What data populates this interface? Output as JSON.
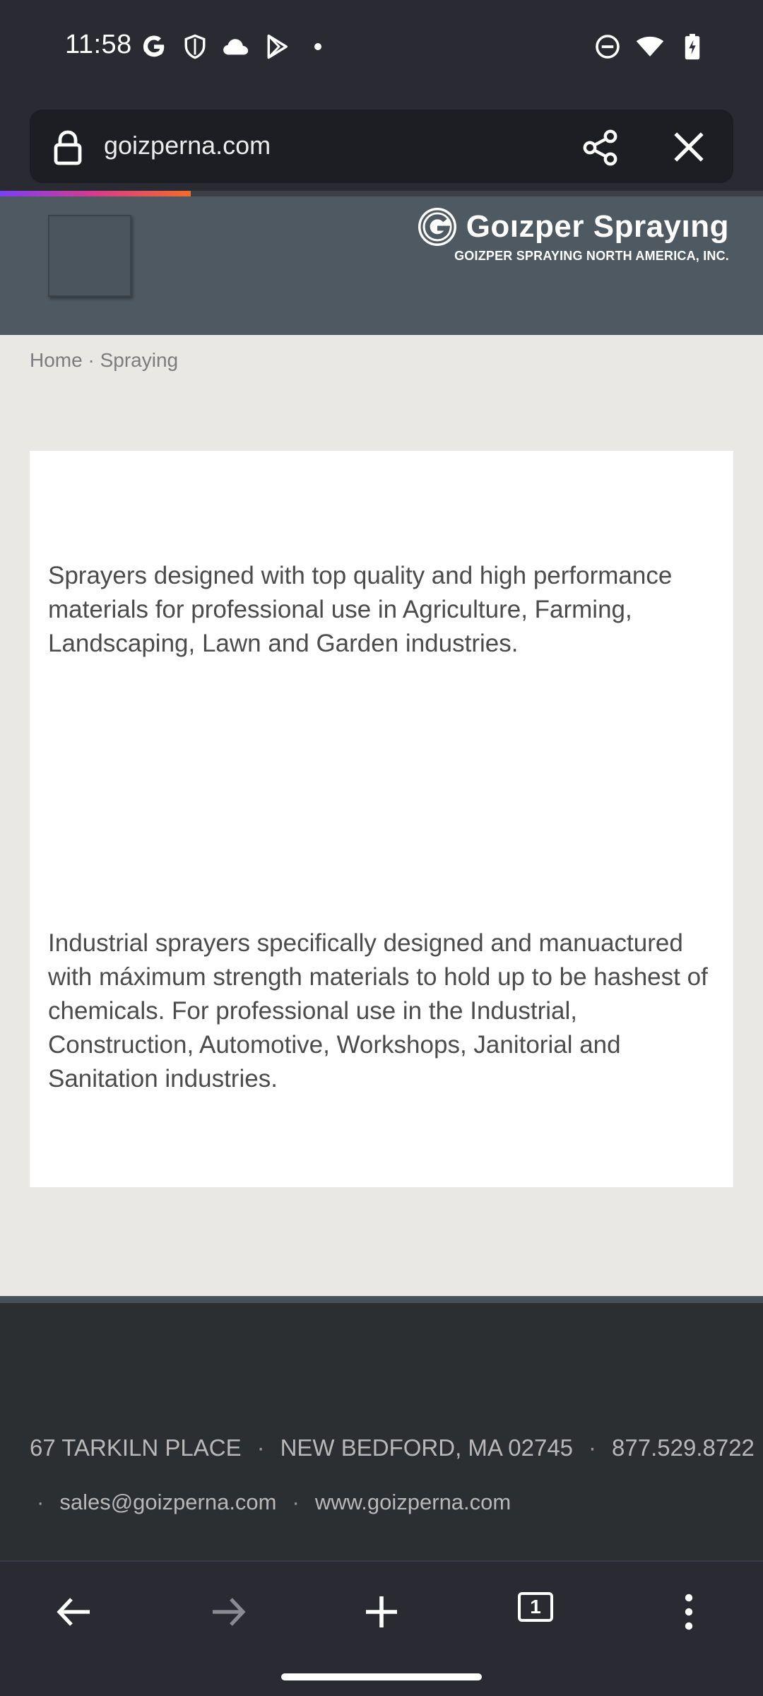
{
  "status_bar": {
    "time": "11:58",
    "left_icons": [
      "google-icon",
      "shield-icon",
      "cloud-icon",
      "play-store-icon",
      "notification-dot-icon"
    ],
    "right_icons": [
      "do-not-disturb-icon",
      "wifi-icon",
      "battery-charging-icon"
    ]
  },
  "browser": {
    "url": "goizperna.com",
    "load_progress_percent": 25,
    "tab_count": "1"
  },
  "site": {
    "logo_name": "Goızper Sprayıng",
    "logo_sub": "GOIZPER SPRAYING NORTH AMERICA, INC.",
    "breadcrumb": {
      "home": "Home",
      "separator": "·",
      "current": "Spraying"
    },
    "paragraphs": [
      "Sprayers designed with top quality and high performance materials for professional use in Agriculture, Farming, Landscaping, Lawn and Garden industries.",
      "Industrial sprayers specifically designed and manuactured with máximum strength materials to hold up to be hashest of chemicals. For professional use in the Industrial, Construction, Automotive, Workshops, Janitorial and Sanitation industries."
    ],
    "footer": {
      "address": "67 TARKILN PLACE",
      "city": "NEW BEDFORD, MA 02745",
      "phone": "877.529.8722",
      "email": "sales@goizperna.com",
      "website": "www.goizperna.com",
      "separator": "·"
    }
  },
  "colors": {
    "chrome": "#2a2a33",
    "header": "#4e5962",
    "page_bg": "#e9e8e4",
    "footer": "#2c2f31"
  }
}
